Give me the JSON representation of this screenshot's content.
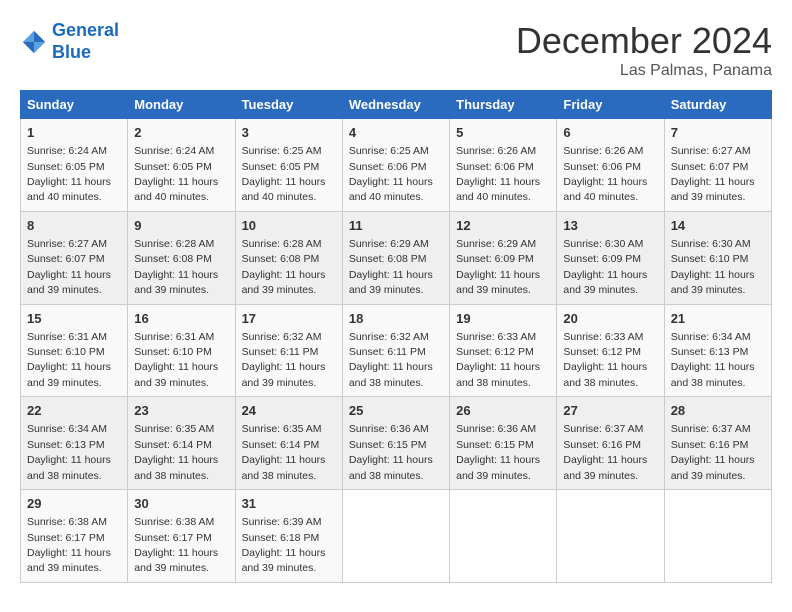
{
  "logo": {
    "line1": "General",
    "line2": "Blue"
  },
  "title": "December 2024",
  "subtitle": "Las Palmas, Panama",
  "days_of_week": [
    "Sunday",
    "Monday",
    "Tuesday",
    "Wednesday",
    "Thursday",
    "Friday",
    "Saturday"
  ],
  "weeks": [
    [
      {
        "day": "1",
        "info": "Sunrise: 6:24 AM\nSunset: 6:05 PM\nDaylight: 11 hours and 40 minutes."
      },
      {
        "day": "2",
        "info": "Sunrise: 6:24 AM\nSunset: 6:05 PM\nDaylight: 11 hours and 40 minutes."
      },
      {
        "day": "3",
        "info": "Sunrise: 6:25 AM\nSunset: 6:05 PM\nDaylight: 11 hours and 40 minutes."
      },
      {
        "day": "4",
        "info": "Sunrise: 6:25 AM\nSunset: 6:06 PM\nDaylight: 11 hours and 40 minutes."
      },
      {
        "day": "5",
        "info": "Sunrise: 6:26 AM\nSunset: 6:06 PM\nDaylight: 11 hours and 40 minutes."
      },
      {
        "day": "6",
        "info": "Sunrise: 6:26 AM\nSunset: 6:06 PM\nDaylight: 11 hours and 40 minutes."
      },
      {
        "day": "7",
        "info": "Sunrise: 6:27 AM\nSunset: 6:07 PM\nDaylight: 11 hours and 39 minutes."
      }
    ],
    [
      {
        "day": "8",
        "info": "Sunrise: 6:27 AM\nSunset: 6:07 PM\nDaylight: 11 hours and 39 minutes."
      },
      {
        "day": "9",
        "info": "Sunrise: 6:28 AM\nSunset: 6:08 PM\nDaylight: 11 hours and 39 minutes."
      },
      {
        "day": "10",
        "info": "Sunrise: 6:28 AM\nSunset: 6:08 PM\nDaylight: 11 hours and 39 minutes."
      },
      {
        "day": "11",
        "info": "Sunrise: 6:29 AM\nSunset: 6:08 PM\nDaylight: 11 hours and 39 minutes."
      },
      {
        "day": "12",
        "info": "Sunrise: 6:29 AM\nSunset: 6:09 PM\nDaylight: 11 hours and 39 minutes."
      },
      {
        "day": "13",
        "info": "Sunrise: 6:30 AM\nSunset: 6:09 PM\nDaylight: 11 hours and 39 minutes."
      },
      {
        "day": "14",
        "info": "Sunrise: 6:30 AM\nSunset: 6:10 PM\nDaylight: 11 hours and 39 minutes."
      }
    ],
    [
      {
        "day": "15",
        "info": "Sunrise: 6:31 AM\nSunset: 6:10 PM\nDaylight: 11 hours and 39 minutes."
      },
      {
        "day": "16",
        "info": "Sunrise: 6:31 AM\nSunset: 6:10 PM\nDaylight: 11 hours and 39 minutes."
      },
      {
        "day": "17",
        "info": "Sunrise: 6:32 AM\nSunset: 6:11 PM\nDaylight: 11 hours and 39 minutes."
      },
      {
        "day": "18",
        "info": "Sunrise: 6:32 AM\nSunset: 6:11 PM\nDaylight: 11 hours and 38 minutes."
      },
      {
        "day": "19",
        "info": "Sunrise: 6:33 AM\nSunset: 6:12 PM\nDaylight: 11 hours and 38 minutes."
      },
      {
        "day": "20",
        "info": "Sunrise: 6:33 AM\nSunset: 6:12 PM\nDaylight: 11 hours and 38 minutes."
      },
      {
        "day": "21",
        "info": "Sunrise: 6:34 AM\nSunset: 6:13 PM\nDaylight: 11 hours and 38 minutes."
      }
    ],
    [
      {
        "day": "22",
        "info": "Sunrise: 6:34 AM\nSunset: 6:13 PM\nDaylight: 11 hours and 38 minutes."
      },
      {
        "day": "23",
        "info": "Sunrise: 6:35 AM\nSunset: 6:14 PM\nDaylight: 11 hours and 38 minutes."
      },
      {
        "day": "24",
        "info": "Sunrise: 6:35 AM\nSunset: 6:14 PM\nDaylight: 11 hours and 38 minutes."
      },
      {
        "day": "25",
        "info": "Sunrise: 6:36 AM\nSunset: 6:15 PM\nDaylight: 11 hours and 38 minutes."
      },
      {
        "day": "26",
        "info": "Sunrise: 6:36 AM\nSunset: 6:15 PM\nDaylight: 11 hours and 39 minutes."
      },
      {
        "day": "27",
        "info": "Sunrise: 6:37 AM\nSunset: 6:16 PM\nDaylight: 11 hours and 39 minutes."
      },
      {
        "day": "28",
        "info": "Sunrise: 6:37 AM\nSunset: 6:16 PM\nDaylight: 11 hours and 39 minutes."
      }
    ],
    [
      {
        "day": "29",
        "info": "Sunrise: 6:38 AM\nSunset: 6:17 PM\nDaylight: 11 hours and 39 minutes."
      },
      {
        "day": "30",
        "info": "Sunrise: 6:38 AM\nSunset: 6:17 PM\nDaylight: 11 hours and 39 minutes."
      },
      {
        "day": "31",
        "info": "Sunrise: 6:39 AM\nSunset: 6:18 PM\nDaylight: 11 hours and 39 minutes."
      },
      null,
      null,
      null,
      null
    ]
  ]
}
